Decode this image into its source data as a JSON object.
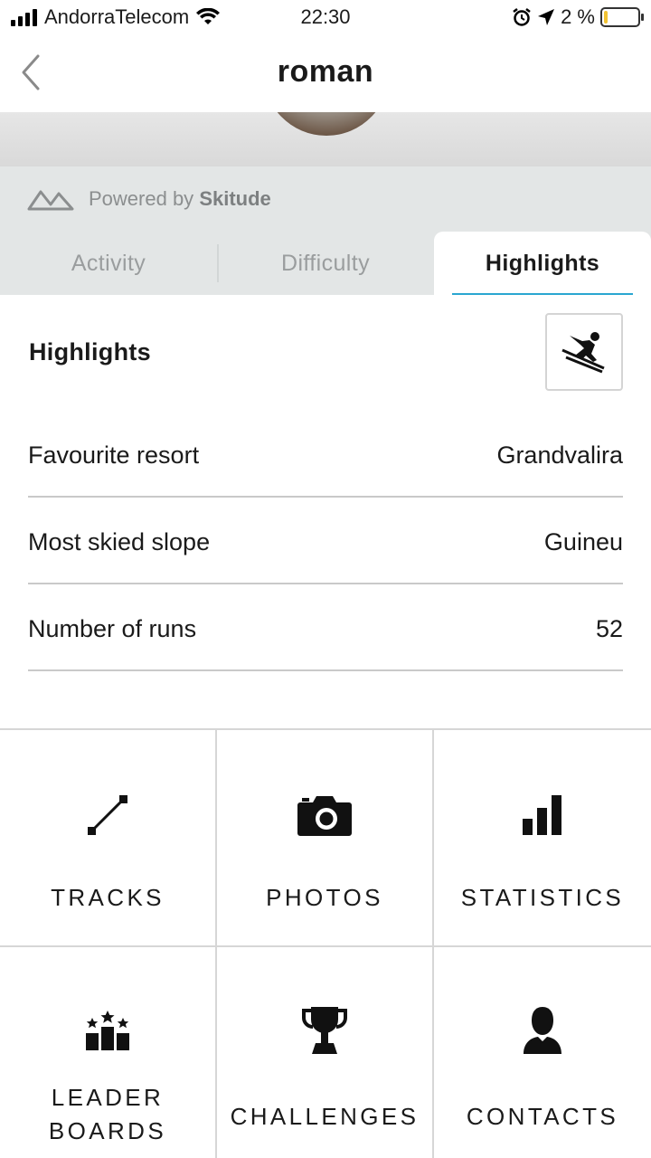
{
  "status_bar": {
    "carrier": "AndorraTelecom",
    "time": "22:30",
    "battery_percent": "2 %"
  },
  "nav": {
    "title": "roman"
  },
  "powered": {
    "prefix": "Powered by",
    "brand": "Skitude"
  },
  "tabs": [
    {
      "label": "Activity",
      "active": false
    },
    {
      "label": "Difficulty",
      "active": false
    },
    {
      "label": "Highlights",
      "active": true
    }
  ],
  "highlights": {
    "title": "Highlights",
    "rows": [
      {
        "label": "Favourite resort",
        "value": "Grandvalira"
      },
      {
        "label": "Most skied slope",
        "value": "Guineu"
      },
      {
        "label": "Number of runs",
        "value": "52"
      }
    ]
  },
  "menu": [
    {
      "label": "TRACKS",
      "icon": "tracks-icon"
    },
    {
      "label": "PHOTOS",
      "icon": "camera-icon"
    },
    {
      "label": "STATISTICS",
      "icon": "bar-chart-icon"
    },
    {
      "label_line1": "LEADER",
      "label_line2": "BOARDS",
      "icon": "leaderboard-icon"
    },
    {
      "label": "CHALLENGES",
      "icon": "trophy-icon"
    },
    {
      "label": "CONTACTS",
      "icon": "person-icon"
    }
  ],
  "colors": {
    "accent": "#2aa6d1",
    "battery": "#f1c232"
  }
}
